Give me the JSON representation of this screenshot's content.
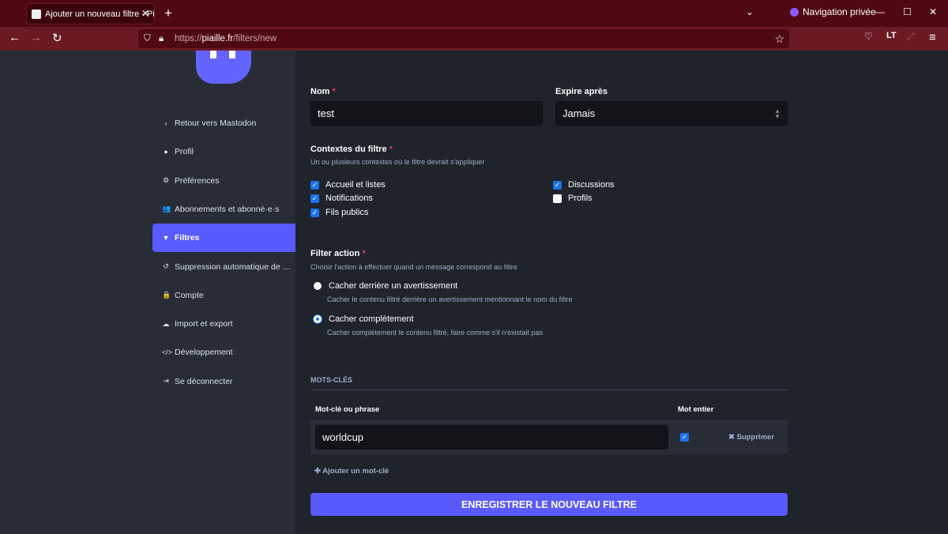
{
  "browser": {
    "tab_title": "Ajouter un nouveau filtre - Piaille",
    "private_label": "Navigation privée",
    "url_prefix": "https://",
    "url_domain": "piaille.fr",
    "url_path": "/filters/new"
  },
  "sidebar": {
    "items": [
      {
        "label": "Retour vers Mastodon",
        "icon": "‹"
      },
      {
        "label": "Profil",
        "icon": "●"
      },
      {
        "label": "Préférences",
        "icon": "⚙"
      },
      {
        "label": "Abonnements et abonné·e·s",
        "icon": "👥"
      },
      {
        "label": "Filtres",
        "icon": "▼",
        "active": true
      },
      {
        "label": "Suppression automatique de …",
        "icon": "↺"
      },
      {
        "label": "Compte",
        "icon": "🔒"
      },
      {
        "label": "Import et export",
        "icon": "☁"
      },
      {
        "label": "Développement",
        "icon": "</>"
      },
      {
        "label": "Se déconnecter",
        "icon": "⇥"
      }
    ]
  },
  "form": {
    "name_label": "Nom",
    "name_value": "test",
    "expire_label": "Expire après",
    "expire_value": "Jamais",
    "contexts_label": "Contextes du filtre",
    "contexts_hint": "Un ou plusieurs contextes où le filtre devrait s'appliquer",
    "contexts": [
      {
        "label": "Accueil et listes",
        "checked": true
      },
      {
        "label": "Notifications",
        "checked": true
      },
      {
        "label": "Fils publics",
        "checked": true
      },
      {
        "label": "Discussions",
        "checked": true
      },
      {
        "label": "Profils",
        "checked": false
      }
    ],
    "action_label": "Filter action",
    "action_hint": "Choisir l'action à effectuer quand un message correspond au filtre",
    "actions": [
      {
        "label": "Cacher derrière un avertissement",
        "hint": "Cacher le contenu filtré derrière un avertissement mentionnant le nom du filtre",
        "selected": false
      },
      {
        "label": "Cacher complètement",
        "hint": "Cacher complètement le contenu filtré, faire comme s'il n'existait pas",
        "selected": true
      }
    ],
    "keywords_section": "MOTS-CLÉS",
    "col_keyword": "Mot-clé ou phrase",
    "col_whole": "Mot entier",
    "keyword_value": "worldcup",
    "delete_label": "Supprimer",
    "add_keyword": "Ajouter un mot-clé",
    "submit": "ENREGISTRER LE NOUVEAU FILTRE"
  },
  "colors": {
    "accent": "#595aff",
    "browser": "#4f0910"
  }
}
